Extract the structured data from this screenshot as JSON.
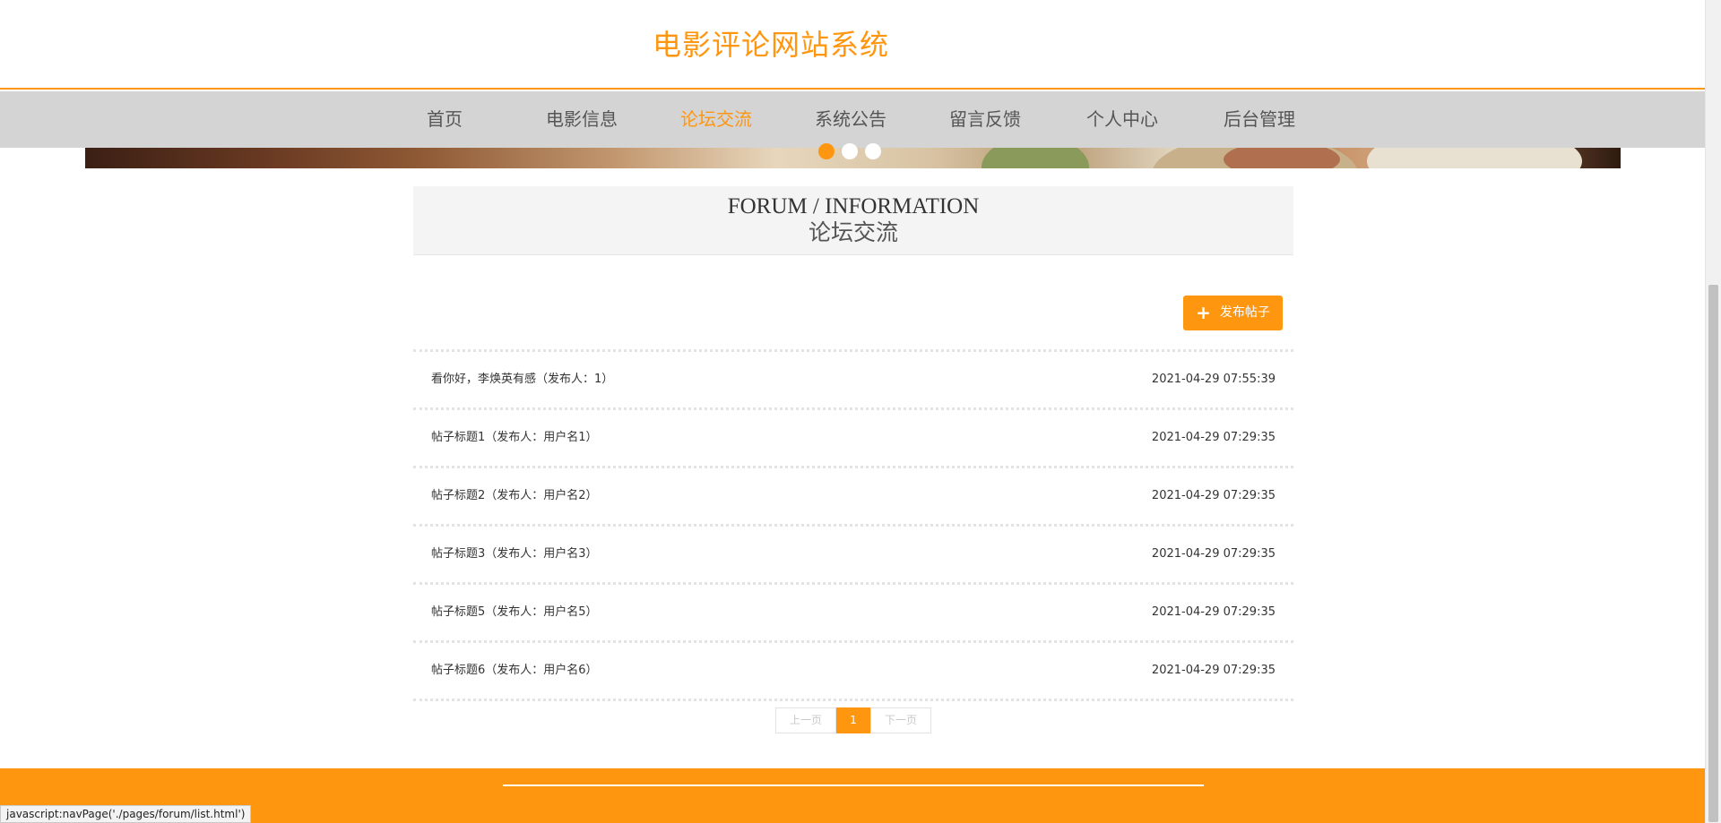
{
  "site": {
    "title": "电影评论网站系统"
  },
  "nav": {
    "items": [
      {
        "label": "首页"
      },
      {
        "label": "电影信息"
      },
      {
        "label": "论坛交流",
        "active": true
      },
      {
        "label": "系统公告"
      },
      {
        "label": "留言反馈"
      },
      {
        "label": "个人中心"
      },
      {
        "label": "后台管理"
      }
    ]
  },
  "banner": {
    "slide_count": 3,
    "active_slide": 1
  },
  "section": {
    "title_en": "FORUM / INFORMATION",
    "title_cn": "论坛交流"
  },
  "actions": {
    "publish_label": "发布帖子",
    "publish_icon": "plus-icon"
  },
  "posts": [
    {
      "title": "看你好，李焕英有感（发布人：1）",
      "time": "2021-04-29 07:55:39"
    },
    {
      "title": "帖子标题1（发布人：用户名1）",
      "time": "2021-04-29 07:29:35"
    },
    {
      "title": "帖子标题2（发布人：用户名2）",
      "time": "2021-04-29 07:29:35"
    },
    {
      "title": "帖子标题3（发布人：用户名3）",
      "time": "2021-04-29 07:29:35"
    },
    {
      "title": "帖子标题5（发布人：用户名5）",
      "time": "2021-04-29 07:29:35"
    },
    {
      "title": "帖子标题6（发布人：用户名6）",
      "time": "2021-04-29 07:29:35"
    }
  ],
  "pagination": {
    "prev_label": "上一页",
    "current_page": "1",
    "next_label": "下一页"
  },
  "status_bar": {
    "text": "javascript:navPage('./pages/forum/list.html')"
  },
  "colors": {
    "accent": "#ff9610",
    "nav_background": "#d4d4d4",
    "section_background": "#f4f4f4"
  }
}
